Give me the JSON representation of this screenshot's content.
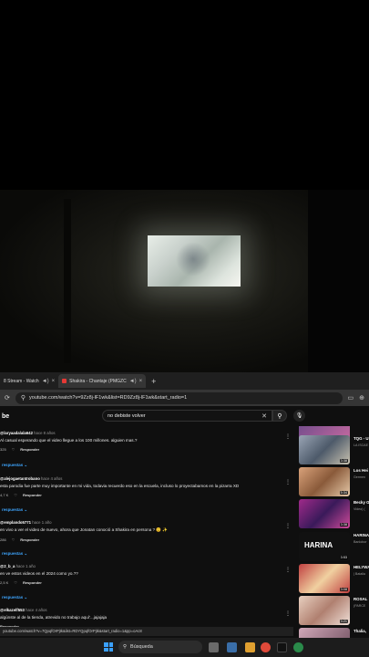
{
  "browser": {
    "tabs": [
      {
        "label": "8 Stream - Watch",
        "active": false
      },
      {
        "label": "Shakira - Chantaje (PMGZC",
        "active": true
      }
    ],
    "url": "youtube.com/watch?v=9Zz8j-lF1wk&list=RD9Zz8j-lF1wk&start_radio=1"
  },
  "youtube": {
    "logo": "be",
    "search_value": "no debiste volver",
    "comments": [
      {
        "user": "@laryaadalala642",
        "time": "hace 8 años",
        "text": "Al casual esperando que el video llegue a los 100 millones. alguien mas.?",
        "likes": "325",
        "reply": "Responder"
      },
      {
        "user": "@alejogaetantrobano",
        "time": "hace 4 años",
        "text": "esta parodia fue parte muy importante en mi vida, todavia recuerdo eso en la escuela, incluso lo proyectabamos en la pizarra XD",
        "likes": "4,7 K",
        "reply": "Responder"
      },
      {
        "user": "@emplando5771",
        "time": "hace 1 año",
        "text": "en vivo a ver el video de nuevo, ahora que Jonatan conoció a Shakira en persona ? 😊 ✨",
        "likes": "286",
        "reply": "Responder"
      },
      {
        "user": "@2_b_a",
        "time": "hace 1 año",
        "text": "en ve estos videos en el 2024 como yo.??",
        "likes": "2,5 K",
        "reply": "Responder"
      },
      {
        "user": "@elkazelf553",
        "time": "hace 4 años",
        "text": "algúnste al de la tienda, atrevido no trabajo aquí'...jajajaja",
        "likes": "",
        "reply": "Responder"
      }
    ],
    "replies_label": "respuestas",
    "side_videos": [
      {
        "title": "",
        "channel": "",
        "duration": ""
      },
      {
        "title": "TQG - U",
        "channel": "LA ISCAE",
        "duration": "3:38"
      },
      {
        "title": "Los Hei",
        "channel": "Germen",
        "duration": "5:34"
      },
      {
        "title": "Becky G",
        "channel": "Video) (",
        "duration": "3:38"
      },
      {
        "title": "HARINA",
        "channel": "Banlobor",
        "duration": "3:53"
      },
      {
        "title": "HELYWA",
        "channel": "| Batalla",
        "duration": "3:08"
      },
      {
        "title": "ROSAL",
        "channel": "(PARCE",
        "duration": "3:21"
      },
      {
        "title": "Thalia,",
        "channel": "",
        "duration": ""
      }
    ]
  },
  "status_url": "youtube.com/watch?v=7QpqfOrPjtk&list=RDYQpqfOrPjtk&start_radio=1&pp=oAc8",
  "taskbar": {
    "search_label": "Búsqueda"
  },
  "colors": {
    "link_blue": "#3ea6ff",
    "yt_red": "#e53935",
    "win_blue": "#3aa0ff"
  }
}
